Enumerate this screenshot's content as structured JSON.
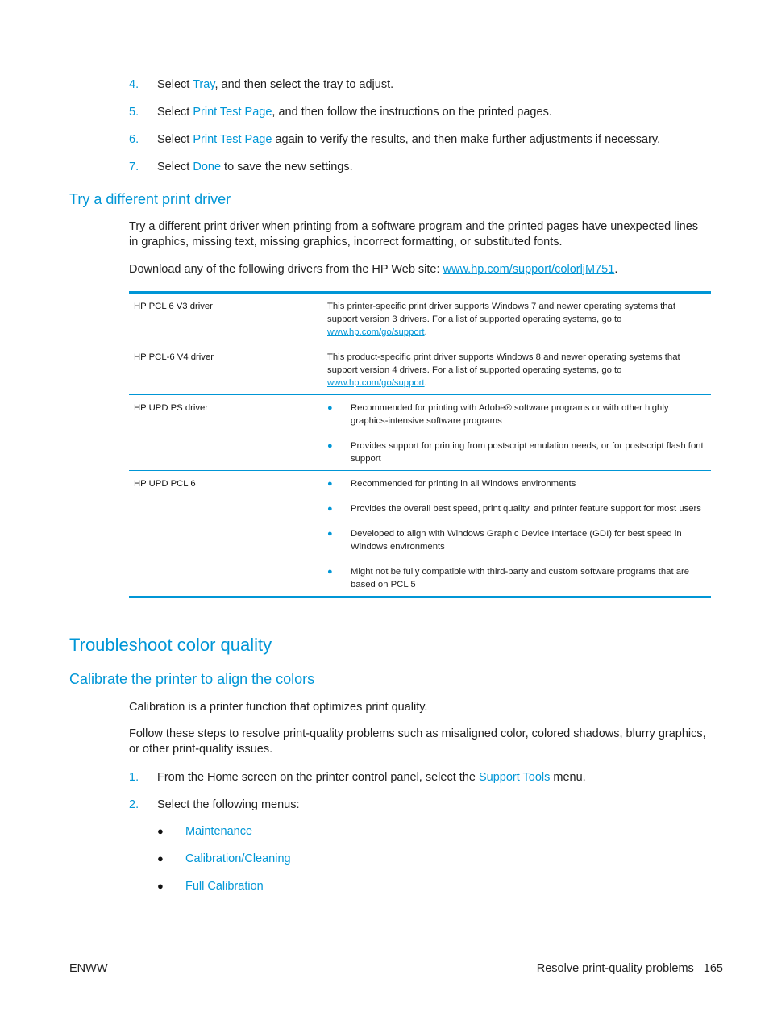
{
  "colors": {
    "accent": "#0096d6",
    "text": "#222222"
  },
  "steps_top": [
    {
      "num": "4.",
      "pre": "Select ",
      "link": "Tray",
      "post": ", and then select the tray to adjust."
    },
    {
      "num": "5.",
      "pre": "Select ",
      "link": "Print Test Page",
      "post": ", and then follow the instructions on the printed pages."
    },
    {
      "num": "6.",
      "pre": "Select ",
      "link": "Print Test Page",
      "post": " again to verify the results, and then make further adjustments if necessary."
    },
    {
      "num": "7.",
      "pre": "Select ",
      "link": "Done",
      "post": " to save the new settings."
    }
  ],
  "driver_section": {
    "heading": "Try a different print driver",
    "intro": "Try a different print driver when printing from a software program and the printed pages have unexpected lines in graphics, missing text, missing graphics, incorrect formatting, or substituted fonts.",
    "download_pre": "Download any of the following drivers from the HP Web site: ",
    "download_link": "www.hp.com/support/colorljM751",
    "download_post": ".",
    "table": [
      {
        "name": "HP PCL 6 V3 driver",
        "desc_pre": "This printer-specific print driver supports Windows 7 and newer operating systems that support version 3 drivers. For a list of supported operating systems, go to ",
        "desc_link": "www.hp.com/go/support",
        "desc_post": "."
      },
      {
        "name": "HP PCL-6 V4 driver",
        "desc_pre": "This product-specific print driver supports Windows 8 and newer operating systems that support version 4 drivers. For a list of supported operating systems, go to ",
        "desc_link": "www.hp.com/go/support",
        "desc_post": "."
      },
      {
        "name": "HP UPD PS driver",
        "bullets": [
          "Recommended for printing with Adobe® software programs or with other highly graphics-intensive software programs",
          "Provides support for printing from postscript emulation needs, or for postscript flash font support"
        ]
      },
      {
        "name": "HP UPD PCL 6",
        "bullets": [
          "Recommended for printing in all Windows environments",
          "Provides the overall best speed, print quality, and printer feature support for most users",
          "Developed to align with Windows Graphic Device Interface (GDI) for best speed in Windows environments",
          "Might not be fully compatible with third-party and custom software programs that are based on PCL 5"
        ]
      }
    ]
  },
  "color_section": {
    "heading": "Troubleshoot color quality",
    "subheading": "Calibrate the printer to align the colors",
    "para1": "Calibration is a printer function that optimizes print quality.",
    "para2": "Follow these steps to resolve print-quality problems such as misaligned color, colored shadows, blurry graphics, or other print-quality issues.",
    "steps": [
      {
        "num": "1.",
        "pre": "From the Home screen on the printer control panel, select the ",
        "link": "Support Tools",
        "post": " menu."
      },
      {
        "num": "2.",
        "pre": "Select the following menus:",
        "link": "",
        "post": ""
      }
    ],
    "menus": [
      "Maintenance",
      "Calibration/Cleaning",
      "Full Calibration"
    ]
  },
  "footer": {
    "left": "ENWW",
    "section": "Resolve print-quality problems",
    "page": "165"
  }
}
